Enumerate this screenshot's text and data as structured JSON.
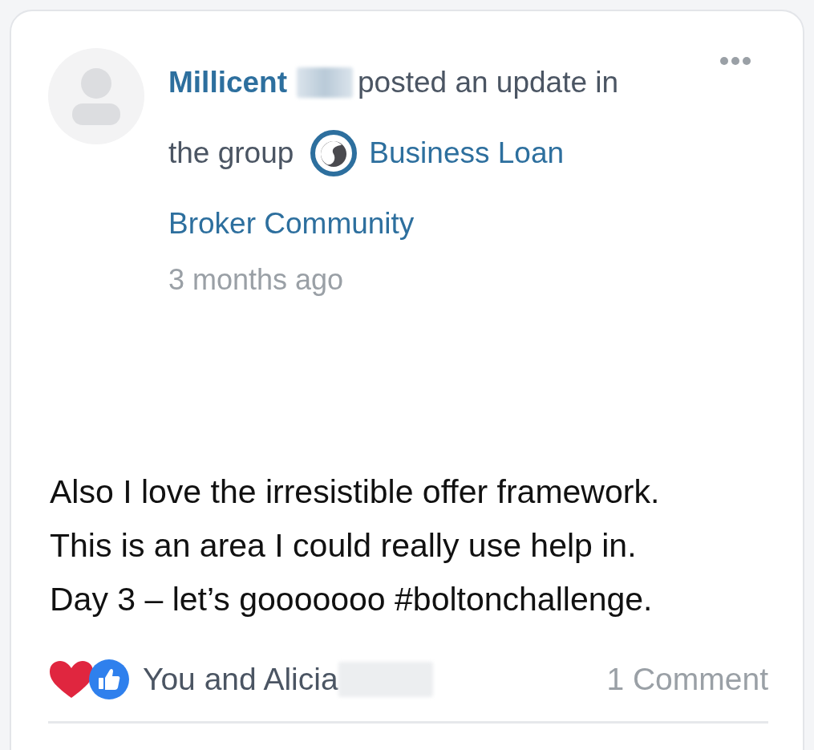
{
  "post": {
    "author": "Millicent",
    "author_redacted": true,
    "action": [
      "posted an update in",
      "the group"
    ],
    "group": [
      "Business Loan",
      "Broker Community"
    ],
    "time": "3 months ago",
    "body": [
      "Also I love the irresistible offer framework.",
      "This is an area I could really use help in.",
      "Day 3 – let’s gooooooo #boltonchallenge."
    ],
    "reactions": [
      {
        "kind": "heart"
      },
      {
        "kind": "like"
      }
    ],
    "reacted_by": "You and Alicia",
    "reacted_by_redacted": true,
    "comments": "1 Comment"
  }
}
